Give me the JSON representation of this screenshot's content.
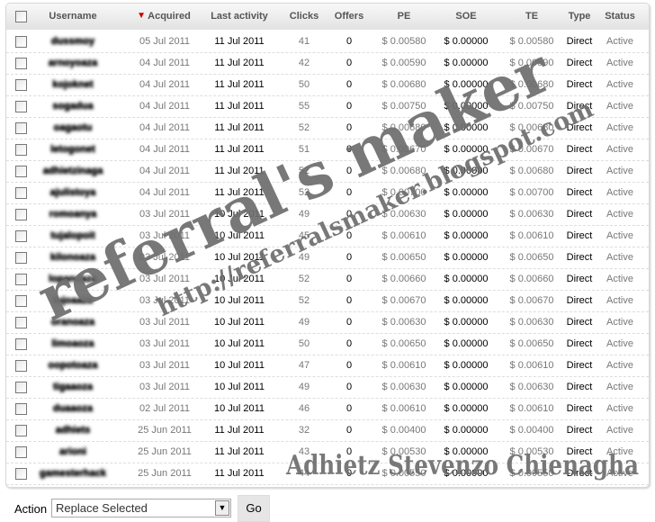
{
  "header": {
    "select_all": false,
    "columns": [
      "Username",
      "Acquired",
      "Last activity",
      "Clicks",
      "Offers",
      "PE",
      "SOE",
      "TE",
      "Type",
      "Status"
    ],
    "sort_column": "Acquired",
    "sort_direction": "descending",
    "sort_color": "#cc0000"
  },
  "rows": [
    {
      "username": "dussmoy",
      "acquired": "05 Jul 2011",
      "last": "11 Jul 2011",
      "clicks": "41",
      "offers": "0",
      "pe": "$ 0.00580",
      "soe": "$ 0.00000",
      "te": "$ 0.00580",
      "type": "Direct",
      "status": "Active"
    },
    {
      "username": "arnoyoaza",
      "acquired": "04 Jul 2011",
      "last": "11 Jul 2011",
      "clicks": "42",
      "offers": "0",
      "pe": "$ 0.00590",
      "soe": "$ 0.00000",
      "te": "$ 0.00590",
      "type": "Direct",
      "status": "Active"
    },
    {
      "username": "kojoknet",
      "acquired": "04 Jul 2011",
      "last": "11 Jul 2011",
      "clicks": "50",
      "offers": "0",
      "pe": "$ 0.00680",
      "soe": "$ 0.00000",
      "te": "$ 0.00680",
      "type": "Direct",
      "status": "Active"
    },
    {
      "username": "sogadua",
      "acquired": "04 Jul 2011",
      "last": "11 Jul 2011",
      "clicks": "55",
      "offers": "0",
      "pe": "$ 0.00750",
      "soe": "$ 0.00000",
      "te": "$ 0.00750",
      "type": "Direct",
      "status": "Active"
    },
    {
      "username": "oagaotu",
      "acquired": "04 Jul 2011",
      "last": "11 Jul 2011",
      "clicks": "52",
      "offers": "0",
      "pe": "$ 0.00680",
      "soe": "$ 0.00000",
      "te": "$ 0.00680",
      "type": "Direct",
      "status": "Active"
    },
    {
      "username": "letogonet",
      "acquired": "04 Jul 2011",
      "last": "11 Jul 2011",
      "clicks": "51",
      "offers": "0",
      "pe": "$ 0.00670",
      "soe": "$ 0.00000",
      "te": "$ 0.00670",
      "type": "Direct",
      "status": "Active"
    },
    {
      "username": "adhietzinaga",
      "acquired": "04 Jul 2011",
      "last": "11 Jul 2011",
      "clicks": "52",
      "offers": "0",
      "pe": "$ 0.00680",
      "soe": "$ 0.00000",
      "te": "$ 0.00680",
      "type": "Direct",
      "status": "Active"
    },
    {
      "username": "ajulistoya",
      "acquired": "04 Jul 2011",
      "last": "11 Jul 2011",
      "clicks": "52",
      "offers": "0",
      "pe": "$ 0.00700",
      "soe": "$ 0.00000",
      "te": "$ 0.00700",
      "type": "Direct",
      "status": "Active"
    },
    {
      "username": "romoanya",
      "acquired": "03 Jul 2011",
      "last": "10 Jul 2011",
      "clicks": "49",
      "offers": "0",
      "pe": "$ 0.00630",
      "soe": "$ 0.00000",
      "te": "$ 0.00630",
      "type": "Direct",
      "status": "Active"
    },
    {
      "username": "tujalopoit",
      "acquired": "03 Jul 2011",
      "last": "10 Jul 2011",
      "clicks": "45",
      "offers": "0",
      "pe": "$ 0.00610",
      "soe": "$ 0.00000",
      "te": "$ 0.00610",
      "type": "Direct",
      "status": "Active"
    },
    {
      "username": "kilonoaza",
      "acquired": "03 Jul 2011",
      "last": "10 Jul 2011",
      "clicks": "49",
      "offers": "0",
      "pe": "$ 0.00650",
      "soe": "$ 0.00000",
      "te": "$ 0.00650",
      "type": "Direct",
      "status": "Active"
    },
    {
      "username": "lopanoaza",
      "acquired": "03 Jul 2011",
      "last": "10 Jul 2011",
      "clicks": "52",
      "offers": "0",
      "pe": "$ 0.00660",
      "soe": "$ 0.00000",
      "te": "$ 0.00660",
      "type": "Direct",
      "status": "Active"
    },
    {
      "username": "tujoaaza",
      "acquired": "03 Jul 2011",
      "last": "10 Jul 2011",
      "clicks": "52",
      "offers": "0",
      "pe": "$ 0.00670",
      "soe": "$ 0.00000",
      "te": "$ 0.00670",
      "type": "Direct",
      "status": "Active"
    },
    {
      "username": "oranoaza",
      "acquired": "03 Jul 2011",
      "last": "10 Jul 2011",
      "clicks": "49",
      "offers": "0",
      "pe": "$ 0.00630",
      "soe": "$ 0.00000",
      "te": "$ 0.00630",
      "type": "Direct",
      "status": "Active"
    },
    {
      "username": "limoaoza",
      "acquired": "03 Jul 2011",
      "last": "10 Jul 2011",
      "clicks": "50",
      "offers": "0",
      "pe": "$ 0.00650",
      "soe": "$ 0.00000",
      "te": "$ 0.00650",
      "type": "Direct",
      "status": "Active"
    },
    {
      "username": "oopotoaza",
      "acquired": "03 Jul 2011",
      "last": "10 Jul 2011",
      "clicks": "47",
      "offers": "0",
      "pe": "$ 0.00610",
      "soe": "$ 0.00000",
      "te": "$ 0.00610",
      "type": "Direct",
      "status": "Active"
    },
    {
      "username": "tigaaoza",
      "acquired": "03 Jul 2011",
      "last": "10 Jul 2011",
      "clicks": "49",
      "offers": "0",
      "pe": "$ 0.00630",
      "soe": "$ 0.00000",
      "te": "$ 0.00630",
      "type": "Direct",
      "status": "Active"
    },
    {
      "username": "duaaoza",
      "acquired": "02 Jul 2011",
      "last": "10 Jul 2011",
      "clicks": "46",
      "offers": "0",
      "pe": "$ 0.00610",
      "soe": "$ 0.00000",
      "te": "$ 0.00610",
      "type": "Direct",
      "status": "Active"
    },
    {
      "username": "adhiets",
      "acquired": "25 Jun 2011",
      "last": "11 Jul 2011",
      "clicks": "32",
      "offers": "0",
      "pe": "$ 0.00400",
      "soe": "$ 0.00000",
      "te": "$ 0.00400",
      "type": "Direct",
      "status": "Active"
    },
    {
      "username": "arioni",
      "acquired": "25 Jun 2011",
      "last": "11 Jul 2011",
      "clicks": "43",
      "offers": "0",
      "pe": "$ 0.00530",
      "soe": "$ 0.00000",
      "te": "$ 0.00530",
      "type": "Direct",
      "status": "Active"
    },
    {
      "username": "gamesterhack",
      "acquired": "25 Jun 2011",
      "last": "11 Jul 2011",
      "clicks": "44",
      "offers": "0",
      "pe": "$ 0.00550",
      "soe": "$ 0.00000",
      "te": "$ 0.00550",
      "type": "Direct",
      "status": "Active"
    }
  ],
  "watermarks": {
    "big": "referral's maker",
    "url": "http://referralsmaker.blogspot.com",
    "author": "Adhietz Stevenzo Chienagha"
  },
  "footer": {
    "action_label": "Action",
    "action_value": "Replace Selected",
    "go_label": "Go"
  }
}
